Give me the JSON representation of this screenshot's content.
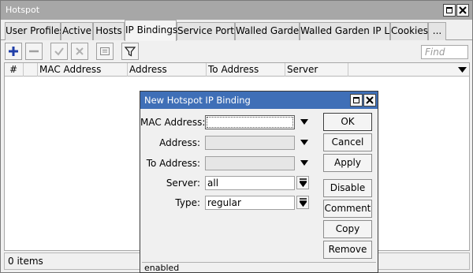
{
  "window": {
    "title": "Hotspot"
  },
  "tabs": [
    {
      "label": "User Profiles"
    },
    {
      "label": "Active"
    },
    {
      "label": "Hosts"
    },
    {
      "label": "IP Bindings"
    },
    {
      "label": "Service Ports"
    },
    {
      "label": "Walled Garden"
    },
    {
      "label": "Walled Garden IP List"
    },
    {
      "label": "Cookies"
    },
    {
      "label": "..."
    }
  ],
  "active_tab": "IP Bindings",
  "toolbar": {
    "tools": [
      {
        "icon": "plus-icon",
        "color": "#1f3ea8"
      },
      {
        "icon": "minus-icon"
      },
      {
        "icon": "check-icon"
      },
      {
        "icon": "cross-icon"
      },
      {
        "icon": "comment-icon"
      },
      {
        "icon": "filter-icon"
      }
    ],
    "find_placeholder": "Find"
  },
  "table": {
    "columns": [
      "#",
      "MAC Address",
      "Address",
      "To Address",
      "Server"
    ],
    "rows": []
  },
  "status": {
    "count_text": "0 items"
  },
  "dialog": {
    "title": "New Hotspot IP Binding",
    "fields": {
      "mac_address": {
        "label": "MAC Address:",
        "value": ""
      },
      "address": {
        "label": "Address:",
        "value": ""
      },
      "to_address": {
        "label": "To Address:",
        "value": ""
      },
      "server": {
        "label": "Server:",
        "value": "all"
      },
      "type": {
        "label": "Type:",
        "value": "regular"
      }
    },
    "buttons": {
      "ok": "OK",
      "cancel": "Cancel",
      "apply": "Apply",
      "disable": "Disable",
      "comment": "Comment",
      "copy": "Copy",
      "remove": "Remove"
    },
    "status": "enabled"
  }
}
